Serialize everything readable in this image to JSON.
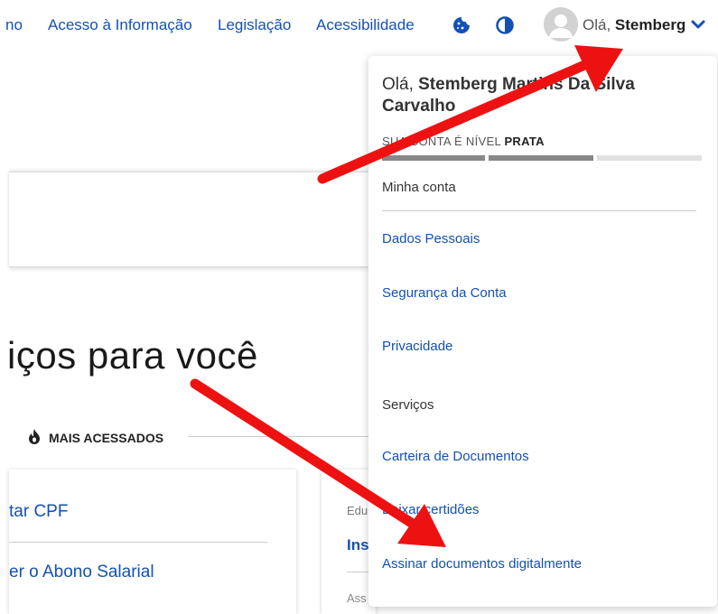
{
  "nav": {
    "links": [
      "no",
      "Acesso à Informação",
      "Legislação",
      "Acessibilidade"
    ],
    "user_prefix": "Olá, ",
    "user_name": "Stemberg"
  },
  "main": {
    "headline": "iços para você",
    "tab_label": "MAIS ACESSADOS",
    "card1_items": [
      "tar CPF",
      "er o Abono Salarial"
    ],
    "card2_kicker": "Edu",
    "card2_title": "Ins",
    "card2_meta": "Ass"
  },
  "dropdown": {
    "greeting_prefix": "Olá, ",
    "full_name": "Stemberg Martins Da Silva Carvalho",
    "level_text": "SUA CONTA É NÍVEL ",
    "level_value": "PRATA",
    "level_progress": "2 of 3",
    "sections": [
      {
        "title": "Minha conta",
        "links": [
          "Dados Pessoais",
          "Segurança da Conta",
          "Privacidade"
        ]
      },
      {
        "title": "Serviços",
        "links": [
          "Carteira de Documentos",
          "Baixar certidões",
          "Assinar documentos digitalmente"
        ]
      }
    ]
  },
  "colors": {
    "link": "#1351b4",
    "annotation_arrow": "#ee1111",
    "level_filled": "#888888",
    "level_empty": "#e0e0e0"
  },
  "icons": [
    "cookie-icon",
    "contrast-icon",
    "avatar-icon",
    "chevron-down-icon",
    "fire-icon"
  ]
}
